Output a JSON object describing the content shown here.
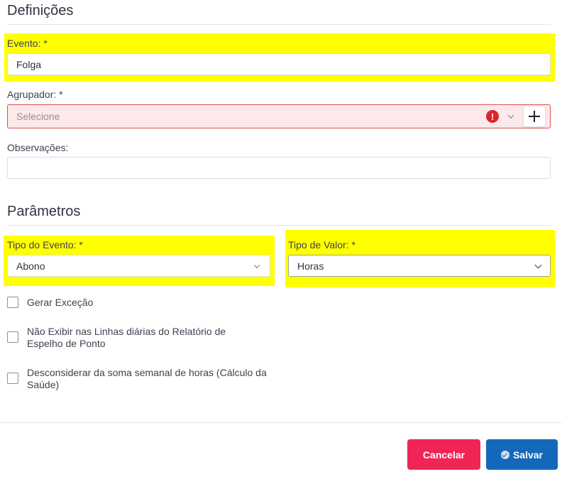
{
  "definicoes": {
    "title": "Definições",
    "evento": {
      "label": "Evento: *",
      "value": "Folga"
    },
    "agrupador": {
      "label": "Agrupador: *",
      "placeholder": "Selecione",
      "error_icon": "!"
    },
    "observacoes": {
      "label": "Observações:",
      "value": ""
    }
  },
  "parametros": {
    "title": "Parâmetros",
    "tipo_evento": {
      "label": "Tipo do Evento: *",
      "value": "Abono"
    },
    "tipo_valor": {
      "label": "Tipo de Valor: *",
      "value": "Horas"
    },
    "checkboxes": [
      {
        "label": "Gerar Exceção",
        "checked": false
      },
      {
        "label": "Não Exibir nas Linhas diárias do Relatório de Espelho de Ponto",
        "checked": false
      },
      {
        "label": "Desconsiderar da soma semanal de horas (Cálculo da Saúde)",
        "checked": false
      }
    ]
  },
  "footer": {
    "cancel_label": "Cancelar",
    "save_label": "Salvar"
  },
  "colors": {
    "highlight": "#ffff00",
    "cancel": "#f12555",
    "save": "#1468b9",
    "error": "#d9262e"
  }
}
